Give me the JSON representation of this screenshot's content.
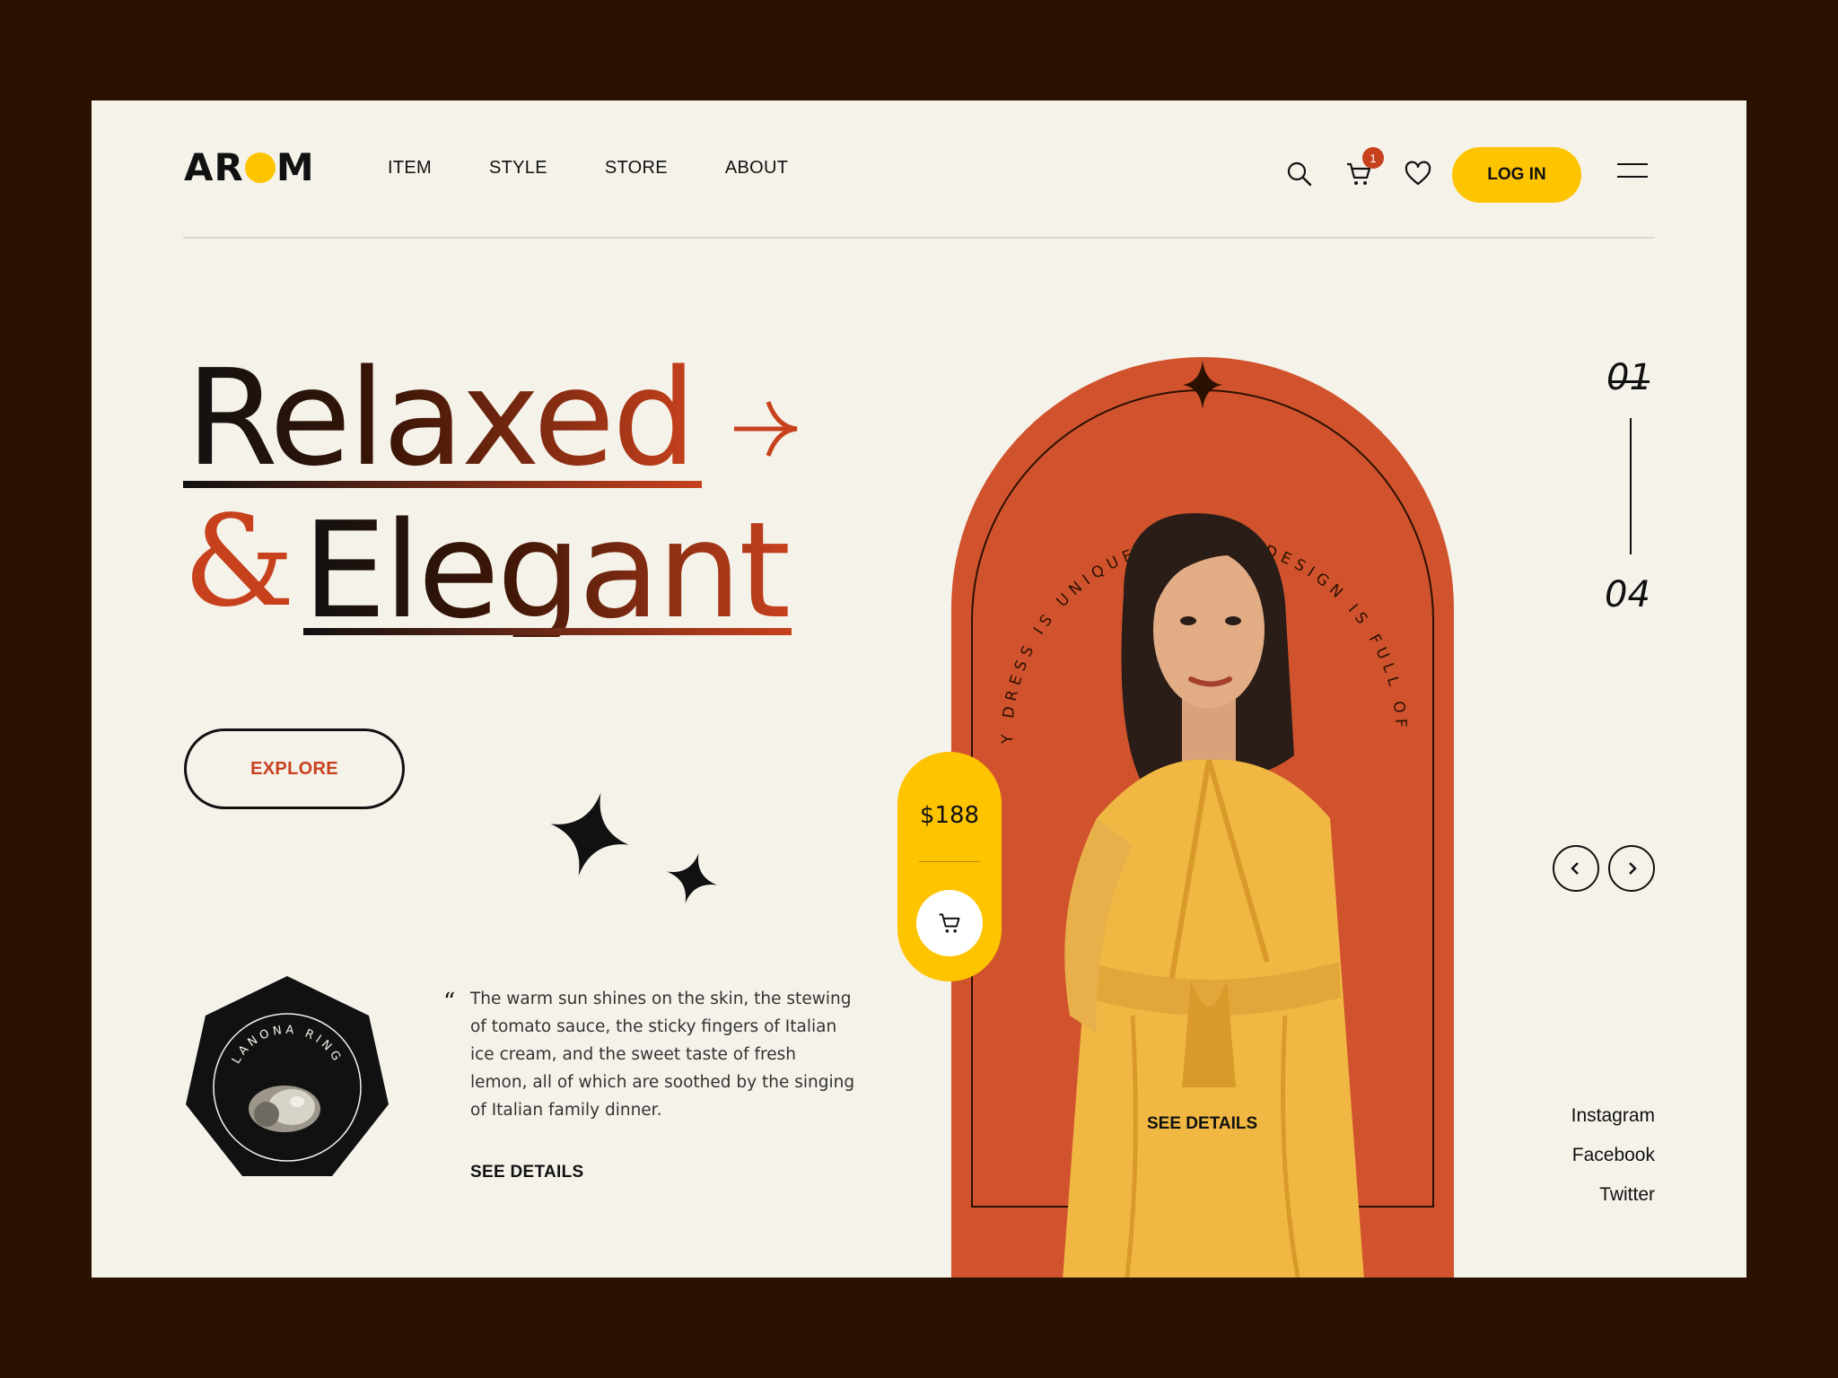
{
  "brand": {
    "logo_left": "AR",
    "logo_right": "M"
  },
  "nav": {
    "items": [
      "ITEM",
      "STYLE",
      "STORE",
      "ABOUT"
    ]
  },
  "header": {
    "cart_count": "1",
    "login_label": "LOG IN"
  },
  "hero": {
    "title_line1": "Relaxed",
    "title_amp": "&",
    "title_line2": "Elegant",
    "explore_label": "EXPLORE"
  },
  "ring_badge": {
    "label": "LANONA RING"
  },
  "quote": {
    "mark": "“",
    "text": "The warm sun shines on the skin, the stewing of tomato sauce, the sticky fingers of Italian ice cream, and the sweet taste of fresh lemon, all of which are soothed by the singing of Italian family dinner.",
    "see_details": "SEE DETAILS"
  },
  "product": {
    "price": "$188",
    "arch_text": "EVERY DRESS IS UNIQUE AND THE DESIGN IS FULL OF LOVE",
    "see_details": "SEE DETAILS"
  },
  "pagination": {
    "current": "01",
    "total": "04"
  },
  "socials": [
    "Instagram",
    "Facebook",
    "Twitter"
  ],
  "colors": {
    "accent_yellow": "#ffc400",
    "accent_orange": "#d1532e",
    "background": "#f5f2ea",
    "frame": "#2b1100"
  }
}
